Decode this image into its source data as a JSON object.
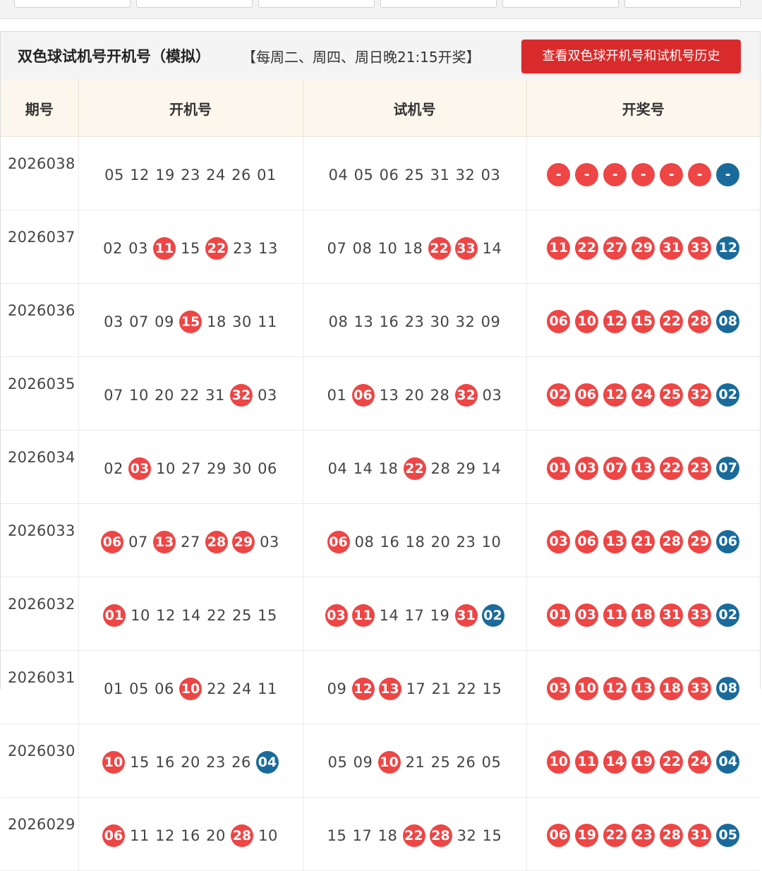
{
  "colors": {
    "red_ball": "#ee4545",
    "blue_ball": "#1a6b9b",
    "button": "#d92b2b",
    "header_bg": "#fcf7ec"
  },
  "panel": {
    "title": "双色球试机号开机号（模拟）",
    "schedule": "【每周二、周四、周日晚21:15开奖】",
    "history_button": "查看双色球开机号和试机号历史"
  },
  "table": {
    "headers": [
      "期号",
      "开机号",
      "试机号",
      "开奖号"
    ],
    "rows": [
      {
        "issue": "2026038",
        "open": [
          [
            "05",
            "n"
          ],
          [
            "12",
            "n"
          ],
          [
            "19",
            "n"
          ],
          [
            "23",
            "n"
          ],
          [
            "24",
            "n"
          ],
          [
            "26",
            "n"
          ],
          [
            "01",
            "n"
          ]
        ],
        "trial": [
          [
            "04",
            "n"
          ],
          [
            "05",
            "n"
          ],
          [
            "06",
            "n"
          ],
          [
            "25",
            "n"
          ],
          [
            "31",
            "n"
          ],
          [
            "32",
            "n"
          ],
          [
            "03",
            "n"
          ]
        ],
        "draw": [
          [
            "-",
            "r"
          ],
          [
            "-",
            "r"
          ],
          [
            "-",
            "r"
          ],
          [
            "-",
            "r"
          ],
          [
            "-",
            "r"
          ],
          [
            "-",
            "r"
          ],
          [
            "-",
            "b"
          ]
        ]
      },
      {
        "issue": "2026037",
        "open": [
          [
            "02",
            "n"
          ],
          [
            "03",
            "n"
          ],
          [
            "11",
            "r"
          ],
          [
            "15",
            "n"
          ],
          [
            "22",
            "r"
          ],
          [
            "23",
            "n"
          ],
          [
            "13",
            "n"
          ]
        ],
        "trial": [
          [
            "07",
            "n"
          ],
          [
            "08",
            "n"
          ],
          [
            "10",
            "n"
          ],
          [
            "18",
            "n"
          ],
          [
            "22",
            "r"
          ],
          [
            "33",
            "r"
          ],
          [
            "14",
            "n"
          ]
        ],
        "draw": [
          [
            "11",
            "r"
          ],
          [
            "22",
            "r"
          ],
          [
            "27",
            "r"
          ],
          [
            "29",
            "r"
          ],
          [
            "31",
            "r"
          ],
          [
            "33",
            "r"
          ],
          [
            "12",
            "b"
          ]
        ]
      },
      {
        "issue": "2026036",
        "open": [
          [
            "03",
            "n"
          ],
          [
            "07",
            "n"
          ],
          [
            "09",
            "n"
          ],
          [
            "15",
            "r"
          ],
          [
            "18",
            "n"
          ],
          [
            "30",
            "n"
          ],
          [
            "11",
            "n"
          ]
        ],
        "trial": [
          [
            "08",
            "n"
          ],
          [
            "13",
            "n"
          ],
          [
            "16",
            "n"
          ],
          [
            "23",
            "n"
          ],
          [
            "30",
            "n"
          ],
          [
            "32",
            "n"
          ],
          [
            "09",
            "n"
          ]
        ],
        "draw": [
          [
            "06",
            "r"
          ],
          [
            "10",
            "r"
          ],
          [
            "12",
            "r"
          ],
          [
            "15",
            "r"
          ],
          [
            "22",
            "r"
          ],
          [
            "28",
            "r"
          ],
          [
            "08",
            "b"
          ]
        ]
      },
      {
        "issue": "2026035",
        "open": [
          [
            "07",
            "n"
          ],
          [
            "10",
            "n"
          ],
          [
            "20",
            "n"
          ],
          [
            "22",
            "n"
          ],
          [
            "31",
            "n"
          ],
          [
            "32",
            "r"
          ],
          [
            "03",
            "n"
          ]
        ],
        "trial": [
          [
            "01",
            "n"
          ],
          [
            "06",
            "r"
          ],
          [
            "13",
            "n"
          ],
          [
            "20",
            "n"
          ],
          [
            "28",
            "n"
          ],
          [
            "32",
            "r"
          ],
          [
            "03",
            "n"
          ]
        ],
        "draw": [
          [
            "02",
            "r"
          ],
          [
            "06",
            "r"
          ],
          [
            "12",
            "r"
          ],
          [
            "24",
            "r"
          ],
          [
            "25",
            "r"
          ],
          [
            "32",
            "r"
          ],
          [
            "02",
            "b"
          ]
        ]
      },
      {
        "issue": "2026034",
        "open": [
          [
            "02",
            "n"
          ],
          [
            "03",
            "r"
          ],
          [
            "10",
            "n"
          ],
          [
            "27",
            "n"
          ],
          [
            "29",
            "n"
          ],
          [
            "30",
            "n"
          ],
          [
            "06",
            "n"
          ]
        ],
        "trial": [
          [
            "04",
            "n"
          ],
          [
            "14",
            "n"
          ],
          [
            "18",
            "n"
          ],
          [
            "22",
            "r"
          ],
          [
            "28",
            "n"
          ],
          [
            "29",
            "n"
          ],
          [
            "14",
            "n"
          ]
        ],
        "draw": [
          [
            "01",
            "r"
          ],
          [
            "03",
            "r"
          ],
          [
            "07",
            "r"
          ],
          [
            "13",
            "r"
          ],
          [
            "22",
            "r"
          ],
          [
            "23",
            "r"
          ],
          [
            "07",
            "b"
          ]
        ]
      },
      {
        "issue": "2026033",
        "open": [
          [
            "06",
            "r"
          ],
          [
            "07",
            "n"
          ],
          [
            "13",
            "r"
          ],
          [
            "27",
            "n"
          ],
          [
            "28",
            "r"
          ],
          [
            "29",
            "r"
          ],
          [
            "03",
            "n"
          ]
        ],
        "trial": [
          [
            "06",
            "r"
          ],
          [
            "08",
            "n"
          ],
          [
            "16",
            "n"
          ],
          [
            "18",
            "n"
          ],
          [
            "20",
            "n"
          ],
          [
            "23",
            "n"
          ],
          [
            "10",
            "n"
          ]
        ],
        "draw": [
          [
            "03",
            "r"
          ],
          [
            "06",
            "r"
          ],
          [
            "13",
            "r"
          ],
          [
            "21",
            "r"
          ],
          [
            "28",
            "r"
          ],
          [
            "29",
            "r"
          ],
          [
            "06",
            "b"
          ]
        ]
      },
      {
        "issue": "2026032",
        "open": [
          [
            "01",
            "r"
          ],
          [
            "10",
            "n"
          ],
          [
            "12",
            "n"
          ],
          [
            "14",
            "n"
          ],
          [
            "22",
            "n"
          ],
          [
            "25",
            "n"
          ],
          [
            "15",
            "n"
          ]
        ],
        "trial": [
          [
            "03",
            "r"
          ],
          [
            "11",
            "r"
          ],
          [
            "14",
            "n"
          ],
          [
            "17",
            "n"
          ],
          [
            "19",
            "n"
          ],
          [
            "31",
            "r"
          ],
          [
            "02",
            "b"
          ]
        ],
        "draw": [
          [
            "01",
            "r"
          ],
          [
            "03",
            "r"
          ],
          [
            "11",
            "r"
          ],
          [
            "18",
            "r"
          ],
          [
            "31",
            "r"
          ],
          [
            "33",
            "r"
          ],
          [
            "02",
            "b"
          ]
        ]
      },
      {
        "issue": "2026031",
        "open": [
          [
            "01",
            "n"
          ],
          [
            "05",
            "n"
          ],
          [
            "06",
            "n"
          ],
          [
            "10",
            "r"
          ],
          [
            "22",
            "n"
          ],
          [
            "24",
            "n"
          ],
          [
            "11",
            "n"
          ]
        ],
        "trial": [
          [
            "09",
            "n"
          ],
          [
            "12",
            "r"
          ],
          [
            "13",
            "r"
          ],
          [
            "17",
            "n"
          ],
          [
            "21",
            "n"
          ],
          [
            "22",
            "n"
          ],
          [
            "15",
            "n"
          ]
        ],
        "draw": [
          [
            "03",
            "r"
          ],
          [
            "10",
            "r"
          ],
          [
            "12",
            "r"
          ],
          [
            "13",
            "r"
          ],
          [
            "18",
            "r"
          ],
          [
            "33",
            "r"
          ],
          [
            "08",
            "b"
          ]
        ]
      },
      {
        "issue": "2026030",
        "open": [
          [
            "10",
            "r"
          ],
          [
            "15",
            "n"
          ],
          [
            "16",
            "n"
          ],
          [
            "20",
            "n"
          ],
          [
            "23",
            "n"
          ],
          [
            "26",
            "n"
          ],
          [
            "04",
            "b"
          ]
        ],
        "trial": [
          [
            "05",
            "n"
          ],
          [
            "09",
            "n"
          ],
          [
            "10",
            "r"
          ],
          [
            "21",
            "n"
          ],
          [
            "25",
            "n"
          ],
          [
            "26",
            "n"
          ],
          [
            "05",
            "n"
          ]
        ],
        "draw": [
          [
            "10",
            "r"
          ],
          [
            "11",
            "r"
          ],
          [
            "14",
            "r"
          ],
          [
            "19",
            "r"
          ],
          [
            "22",
            "r"
          ],
          [
            "24",
            "r"
          ],
          [
            "04",
            "b"
          ]
        ]
      },
      {
        "issue": "2026029",
        "open": [
          [
            "06",
            "r"
          ],
          [
            "11",
            "n"
          ],
          [
            "12",
            "n"
          ],
          [
            "16",
            "n"
          ],
          [
            "20",
            "n"
          ],
          [
            "28",
            "r"
          ],
          [
            "10",
            "n"
          ]
        ],
        "trial": [
          [
            "15",
            "n"
          ],
          [
            "17",
            "n"
          ],
          [
            "18",
            "n"
          ],
          [
            "22",
            "r"
          ],
          [
            "28",
            "r"
          ],
          [
            "32",
            "n"
          ],
          [
            "15",
            "n"
          ]
        ],
        "draw": [
          [
            "06",
            "r"
          ],
          [
            "19",
            "r"
          ],
          [
            "22",
            "r"
          ],
          [
            "23",
            "r"
          ],
          [
            "28",
            "r"
          ],
          [
            "31",
            "r"
          ],
          [
            "05",
            "b"
          ]
        ]
      }
    ]
  }
}
